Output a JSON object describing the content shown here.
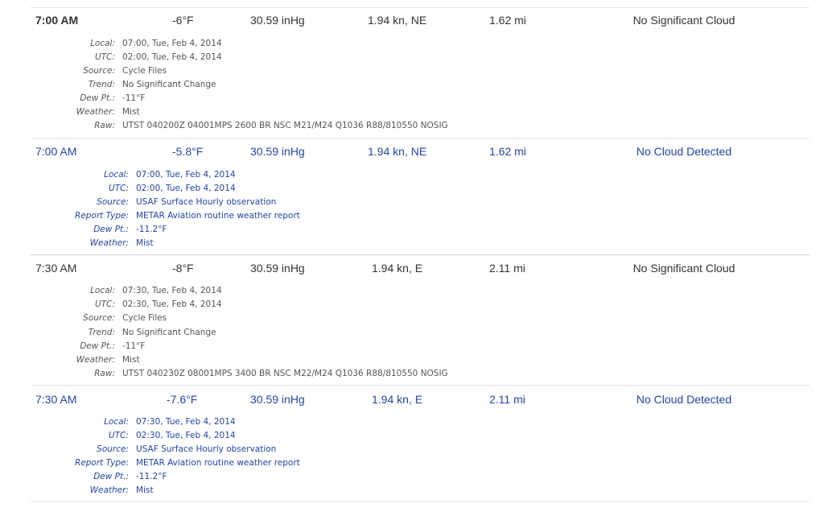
{
  "observations": [
    {
      "time": "7:00 AM",
      "temp": "-6°F",
      "pressure": "30.59 inHg",
      "wind": "1.94 kn, NE",
      "visibility": "1.62 mi",
      "cloud": "No Significant Cloud",
      "details": [
        {
          "label": "Local:",
          "value": "07:00, Tue, Feb 4, 2014"
        },
        {
          "label": "UTC:",
          "value": "02:00, Tue, Feb 4, 2014"
        },
        {
          "label": "Source:",
          "value": "Cycle Files"
        },
        {
          "label": "Trend:",
          "value": "No Significant Change"
        },
        {
          "label": "Dew Pt.:",
          "value": "-11°F"
        },
        {
          "label": "Weather:",
          "value": "Mist"
        },
        {
          "label": "Raw:",
          "value": "UTST 040200Z 04001MPS 2600 BR NSC M21/M24 Q1036 R88/810550 NOSIG"
        }
      ]
    },
    {
      "time": "7:00 AM",
      "temp": "-5.8°F",
      "pressure": "30.59 inHg",
      "wind": "1.94 kn, NE",
      "visibility": "1.62 mi",
      "cloud": "No Cloud Detected",
      "details": [
        {
          "label": "Local:",
          "value": "07:00, Tue, Feb 4, 2014"
        },
        {
          "label": "UTC:",
          "value": "02:00, Tue, Feb 4, 2014"
        },
        {
          "label": "Source:",
          "value": "USAF Surface Hourly observation"
        },
        {
          "label": "Report Type:",
          "value": "METAR Aviation routine weather report"
        },
        {
          "label": "Dew Pt.:",
          "value": "-11.2°F"
        },
        {
          "label": "Weather:",
          "value": "Mist"
        }
      ]
    },
    {
      "time": "7:30 AM",
      "temp": "-8°F",
      "pressure": "30.59 inHg",
      "wind": "1.94 kn, E",
      "visibility": "2.11 mi",
      "cloud": "No Significant Cloud",
      "details": [
        {
          "label": "Local:",
          "value": "07:30, Tue, Feb 4, 2014"
        },
        {
          "label": "UTC:",
          "value": "02:30, Tue, Feb 4, 2014"
        },
        {
          "label": "Source:",
          "value": "Cycle Files"
        },
        {
          "label": "Trend:",
          "value": "No Significant Change"
        },
        {
          "label": "Dew Pt.:",
          "value": "-11°F"
        },
        {
          "label": "Weather:",
          "value": "Mist"
        },
        {
          "label": "Raw:",
          "value": "UTST 040230Z 08001MPS 3400 BR NSC M22/M24 Q1036 R88/810550 NOSIG"
        }
      ]
    },
    {
      "time": "7:30 AM",
      "temp": "-7.6°F",
      "pressure": "30.59 inHg",
      "wind": "1.94 kn, E",
      "visibility": "2.11 mi",
      "cloud": "No Cloud Detected",
      "details": [
        {
          "label": "Local:",
          "value": "07:30, Tue, Feb 4, 2014"
        },
        {
          "label": "UTC:",
          "value": "02:30, Tue, Feb 4, 2014"
        },
        {
          "label": "Source:",
          "value": "USAF Surface Hourly observation"
        },
        {
          "label": "Report Type:",
          "value": "METAR Aviation routine weather report"
        },
        {
          "label": "Dew Pt.:",
          "value": "-11.2°F"
        },
        {
          "label": "Weather:",
          "value": "Mist"
        }
      ]
    }
  ]
}
